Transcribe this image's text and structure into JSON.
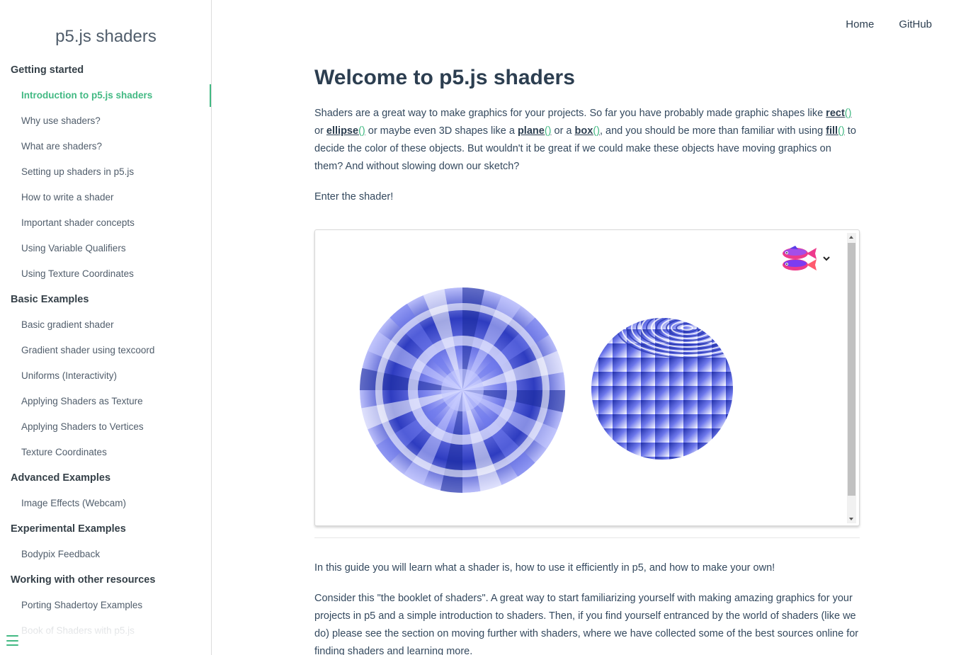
{
  "sidebar": {
    "title": "p5.js shaders",
    "nav": [
      {
        "type": "group",
        "label": "Getting started",
        "name": "nav-group-getting-started"
      },
      {
        "type": "item",
        "label": "Introduction to p5.js shaders",
        "name": "nav-item-introduction",
        "active": true
      },
      {
        "type": "item",
        "label": "Why use shaders?",
        "name": "nav-item-why-use-shaders"
      },
      {
        "type": "item",
        "label": "What are shaders?",
        "name": "nav-item-what-are-shaders"
      },
      {
        "type": "item",
        "label": "Setting up shaders in p5.js",
        "name": "nav-item-setting-up-shaders"
      },
      {
        "type": "item",
        "label": "How to write a shader",
        "name": "nav-item-how-to-write"
      },
      {
        "type": "item",
        "label": "Important shader concepts",
        "name": "nav-item-important-concepts"
      },
      {
        "type": "item",
        "label": "Using Variable Qualifiers",
        "name": "nav-item-variable-qualifiers"
      },
      {
        "type": "item",
        "label": "Using Texture Coordinates",
        "name": "nav-item-texture-coordinates-usage"
      },
      {
        "type": "group",
        "label": "Basic Examples",
        "name": "nav-group-basic-examples"
      },
      {
        "type": "item",
        "label": "Basic gradient shader",
        "name": "nav-item-basic-gradient"
      },
      {
        "type": "item",
        "label": "Gradient shader using texcoord",
        "name": "nav-item-gradient-texcoord"
      },
      {
        "type": "item",
        "label": "Uniforms (Interactivity)",
        "name": "nav-item-uniforms"
      },
      {
        "type": "item",
        "label": "Applying Shaders as Texture",
        "name": "nav-item-shaders-as-texture"
      },
      {
        "type": "item",
        "label": "Applying Shaders to Vertices",
        "name": "nav-item-shaders-to-vertices"
      },
      {
        "type": "item",
        "label": "Texture Coordinates",
        "name": "nav-item-texture-coordinates"
      },
      {
        "type": "group",
        "label": "Advanced Examples",
        "name": "nav-group-advanced-examples"
      },
      {
        "type": "item",
        "label": "Image Effects (Webcam)",
        "name": "nav-item-image-effects"
      },
      {
        "type": "group",
        "label": "Experimental Examples",
        "name": "nav-group-experimental-examples"
      },
      {
        "type": "item",
        "label": "Bodypix Feedback",
        "name": "nav-item-bodypix-feedback"
      },
      {
        "type": "group",
        "label": "Working with other resources",
        "name": "nav-group-other-resources"
      },
      {
        "type": "item",
        "label": "Porting Shadertoy Examples",
        "name": "nav-item-porting-shadertoy"
      },
      {
        "type": "item",
        "label": "Book of Shaders with p5.js",
        "name": "nav-item-book-of-shaders",
        "faded": true
      }
    ]
  },
  "topnav": {
    "home": "Home",
    "github": "GitHub"
  },
  "main": {
    "title": "Welcome to p5.js shaders",
    "intro": {
      "t1": "Shaders are a great way to make graphics for your projects. So far you have probably made graphic shapes like ",
      "rect": "rect",
      "t2": " or ",
      "ellipse": "ellipse",
      "t3": " or maybe even 3D shapes like a ",
      "plane": "plane",
      "t4": " or a ",
      "box": "box",
      "t5": ", and you should be more than familiar with using ",
      "fill": "fill",
      "t6": " to decide the color of these objects. But wouldn't it be great if we could make these objects have moving graphics on them? And without slowing down our sketch?",
      "parens": "()"
    },
    "enter": "Enter the shader!",
    "guide": "In this guide you will learn what a shader is, how to use it efficiently in p5, and how to make your own!",
    "booklet": "Consider this \"the booklet of shaders\". A great way to start familiarizing yourself with making amazing graphics for your projects in p5 and a simple introduction to shaders. Then, if you find yourself entranced by the world of shaders (like we do) please see the section on moving further with shaders, where we have collected some of the best sources online for finding shaders and learning more."
  },
  "colors": {
    "accent": "#42b983",
    "text": "#34495e",
    "heading": "#2c3e50",
    "shader_dark": "#1a2a9a",
    "shader_mid": "#6e78ec",
    "shader_light": "#c9ccff"
  }
}
